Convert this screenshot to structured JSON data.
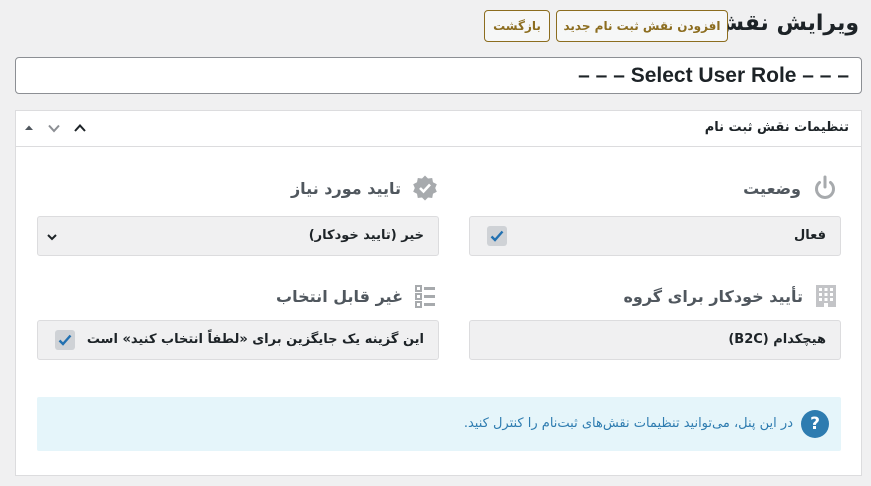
{
  "header": {
    "title": "ویرایش نقش",
    "add_button": "افزودن نقش ثبت نام جدید",
    "back_button": "بازگشت"
  },
  "role_select": {
    "value": "– – – Select User Role – – –"
  },
  "panel": {
    "title": "تنظیمات نقش ثبت نام",
    "fields": {
      "status": {
        "label": "وضعیت",
        "value": "فعال",
        "checked": true,
        "icon": "power-icon"
      },
      "approval": {
        "label": "تایید مورد نیاز",
        "value": "خیر (تایید خودکار)",
        "icon": "verified-badge-icon"
      },
      "group": {
        "label": "تأیید خودکار برای گروه",
        "value": "هیچکدام (B2C)",
        "icon": "building-icon"
      },
      "not_selectable": {
        "label": "غیر قابل انتخاب",
        "value": "این گزینه یک جایگزین برای «لطفاً انتخاب کنید» است",
        "checked": true,
        "icon": "list-checks-icon"
      }
    },
    "info": "در این پنل، می‌توانید تنظیمات نقش‌های ثبت‌نام را کنترل کنید."
  },
  "colors": {
    "accent_brown": "#8c6d1f",
    "info_blue": "#2e7cb0",
    "info_bg": "#e5f5fa",
    "checkbox_check": "#2271b1"
  }
}
